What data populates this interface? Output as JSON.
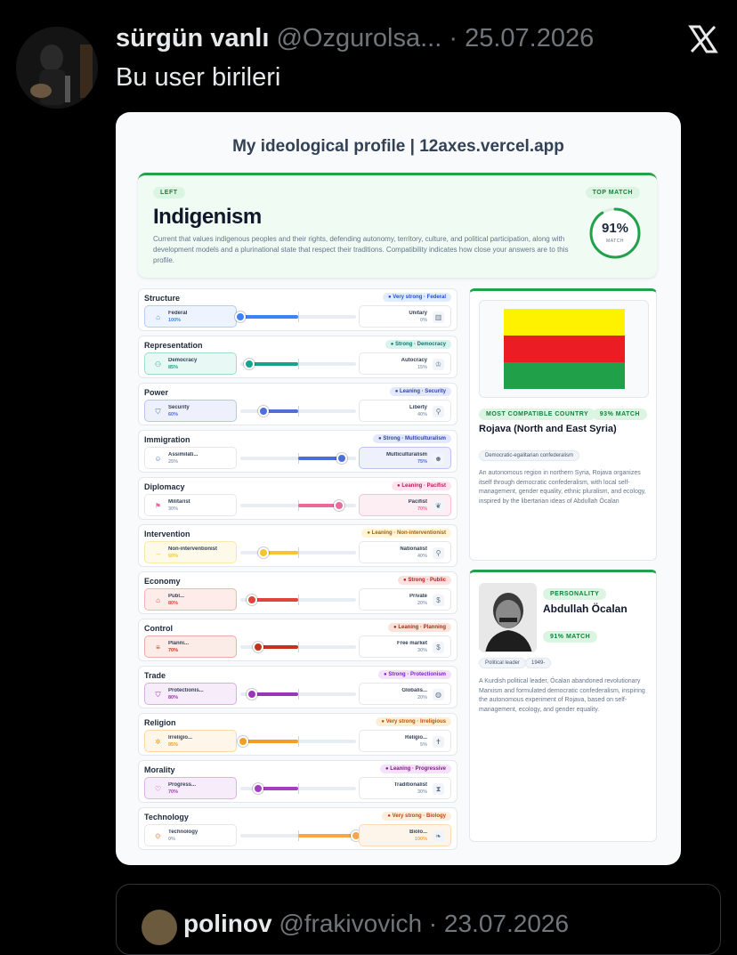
{
  "tweet": {
    "author_name": "sürgün vanlı",
    "handle": "@Ozgurolsa...",
    "separator": "·",
    "date": "25.07.2026",
    "text": "Bu user birileri",
    "close_icon": "x-logo-icon"
  },
  "card": {
    "title": "My ideological profile | 12axes.vercel.app",
    "top": {
      "side_label": "LEFT",
      "top_match_label": "TOP MATCH",
      "ideology": "Indigenism",
      "description": "Current that values indigenous peoples and their rights, defending autonomy, territory, culture, and political participation, along with development models and a plurinational state that respect their traditions. Compatibility indicates how close your answers are to this profile.",
      "match_percent": "91%",
      "match_value": 91,
      "match_label": "MATCH",
      "accent": "#22a04a"
    },
    "axes": [
      {
        "name": "Structure",
        "tag": "● Very strong · Federal",
        "left": "Federal",
        "left_pct": "100%",
        "right": "Unitary",
        "right_pct": "0%",
        "value": 100,
        "winner": "left",
        "color": "#3b82f6",
        "tag_bg": "#e0ecff",
        "tag_color": "#1d4ed8",
        "box_bg": "#eef4ff",
        "left_icon": "bank-icon",
        "right_icon": "building-icon"
      },
      {
        "name": "Representation",
        "tag": "● Strong · Democracy",
        "left": "Democracy",
        "left_pct": "85%",
        "right": "Autocracy",
        "right_pct": "15%",
        "value": 85,
        "winner": "left",
        "color": "#14a58a",
        "tag_bg": "#d7f5ee",
        "tag_color": "#0f766e",
        "box_bg": "#e8f8f4",
        "left_icon": "people-icon",
        "right_icon": "crown-icon"
      },
      {
        "name": "Power",
        "tag": "● Leaning · Security",
        "left": "Security",
        "left_pct": "60%",
        "right": "Liberty",
        "right_pct": "40%",
        "value": 60,
        "winner": "left",
        "color": "#4f6fd6",
        "tag_bg": "#e3e8fb",
        "tag_color": "#3046a8",
        "box_bg": "#eef1fc",
        "left_icon": "shield-icon",
        "right_icon": "torch-icon"
      },
      {
        "name": "Immigration",
        "tag": "● Strong · Multiculturalism",
        "left": "Assimilati...",
        "left_pct": "25%",
        "right": "Multiculturalism",
        "right_pct": "75%",
        "value": 75,
        "winner": "right",
        "color": "#4a6fd8",
        "tag_bg": "#e3e8fb",
        "tag_color": "#3046a8",
        "box_bg": "#eef1fc",
        "left_icon": "user-icon",
        "right_icon": "users-icon"
      },
      {
        "name": "Diplomacy",
        "tag": "● Leaning · Pacifist",
        "left": "Militarist",
        "left_pct": "30%",
        "right": "Pacifist",
        "right_pct": "70%",
        "value": 70,
        "winner": "right",
        "color": "#ec6a9a",
        "tag_bg": "#fde4ee",
        "tag_color": "#be185d",
        "box_bg": "#fdeef4",
        "left_icon": "flag-icon",
        "right_icon": "dove-icon"
      },
      {
        "name": "Intervention",
        "tag": "● Leaning · Non-interventionist",
        "left": "Non-interventionist",
        "left_pct": "60%",
        "right": "Nationalist",
        "right_pct": "40%",
        "value": 60,
        "winner": "left",
        "color": "#f4c531",
        "tag_bg": "#fdf5d6",
        "tag_color": "#a16207",
        "box_bg": "#fefaea",
        "left_icon": "arrow-in-icon",
        "right_icon": "pin-icon"
      },
      {
        "name": "Economy",
        "tag": "● Strong · Public",
        "left": "Publ...",
        "left_pct": "80%",
        "right": "Private",
        "right_pct": "20%",
        "value": 80,
        "winner": "left",
        "color": "#e0443a",
        "tag_bg": "#fde1df",
        "tag_color": "#b91c1c",
        "box_bg": "#fdecea",
        "left_icon": "bank-icon",
        "right_icon": "dollar-icon"
      },
      {
        "name": "Control",
        "tag": "● Leaning · Planning",
        "left": "Planni...",
        "left_pct": "70%",
        "right": "Free market",
        "right_pct": "30%",
        "value": 70,
        "winner": "left",
        "color": "#c2331a",
        "tag_bg": "#fbe3dc",
        "tag_color": "#9a3412",
        "box_bg": "#fcece7",
        "left_icon": "sliders-icon",
        "right_icon": "dollar-icon"
      },
      {
        "name": "Trade",
        "tag": "● Strong · Protectionism",
        "left": "Protectionis...",
        "left_pct": "80%",
        "right": "Globalis...",
        "right_pct": "20%",
        "value": 80,
        "winner": "left",
        "color": "#9b35b8",
        "tag_bg": "#f3e2f8",
        "tag_color": "#7e22ce",
        "box_bg": "#f7ecfa",
        "left_icon": "shield-icon",
        "right_icon": "globe-icon"
      },
      {
        "name": "Religion",
        "tag": "● Very strong · Irreligious",
        "left": "Irreligio...",
        "left_pct": "95%",
        "right": "Religio...",
        "right_pct": "5%",
        "value": 95,
        "winner": "left",
        "color": "#f0a020",
        "tag_bg": "#fdefd6",
        "tag_color": "#b45309",
        "box_bg": "#fef6e8",
        "left_icon": "atom-icon",
        "right_icon": "cross-icon"
      },
      {
        "name": "Morality",
        "tag": "● Leaning · Progressive",
        "left": "Progress...",
        "left_pct": "70%",
        "right": "Traditionalist",
        "right_pct": "30%",
        "value": 70,
        "winner": "left",
        "color": "#a43ec0",
        "tag_bg": "#f3e2f8",
        "tag_color": "#86198f",
        "box_bg": "#f7ecfa",
        "left_icon": "heart-icon",
        "right_icon": "hourglass-icon"
      },
      {
        "name": "Technology",
        "tag": "● Very strong · Biology",
        "left": "Technology",
        "left_pct": "0%",
        "right": "Biolo...",
        "right_pct": "100%",
        "value": 100,
        "winner": "right",
        "color": "#f5a64a",
        "tag_bg": "#fdeedd",
        "tag_color": "#c2410c",
        "box_bg": "#fef5ea",
        "left_icon": "gear-icon",
        "right_icon": "leaf-icon"
      }
    ],
    "country": {
      "label": "MOST COMPATIBLE COUNTRY",
      "match": "93% MATCH",
      "name": "Rojava (North and East Syria)",
      "tag": "Democratic-egalitarian confederalism",
      "description": "An autonomous region in northern Syria, Rojava organizes itself through democratic confederalism, with local self-management, gender equality, ethnic pluralism, and ecology, inspired by the libertarian ideas of Abdullah Öcalan",
      "flag_colors": [
        "#fff200",
        "#ec1c24",
        "#21a04a"
      ]
    },
    "person": {
      "label": "PERSONALITY",
      "name": "Abdullah Öcalan",
      "match": "91% MATCH",
      "tags": [
        "Political leader",
        "1949-"
      ],
      "description": "A Kurdish political leader, Öcalan abandoned revolutionary Marxism and formulated democratic confederalism, inspiring the autonomous experiment of Rojava, based on self-management, ecology, and gender equality."
    }
  },
  "quoted": {
    "author_name": "polinov",
    "handle": "@frakivovich",
    "separator": "·",
    "date": "23.07.2026"
  }
}
